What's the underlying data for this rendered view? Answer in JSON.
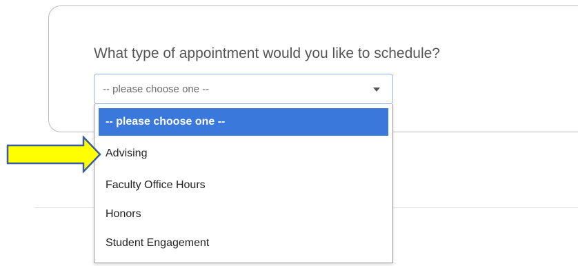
{
  "question": "What type of appointment would you like to schedule?",
  "select": {
    "value": "-- please choose one --"
  },
  "options": [
    "-- please choose one --",
    "Advising",
    "Faculty Office Hours",
    "Honors",
    "Student Engagement"
  ],
  "colors": {
    "selected_bg": "#3b78dc",
    "arrow_fill": "#ffff00",
    "arrow_stroke": "#3a5aa0"
  }
}
